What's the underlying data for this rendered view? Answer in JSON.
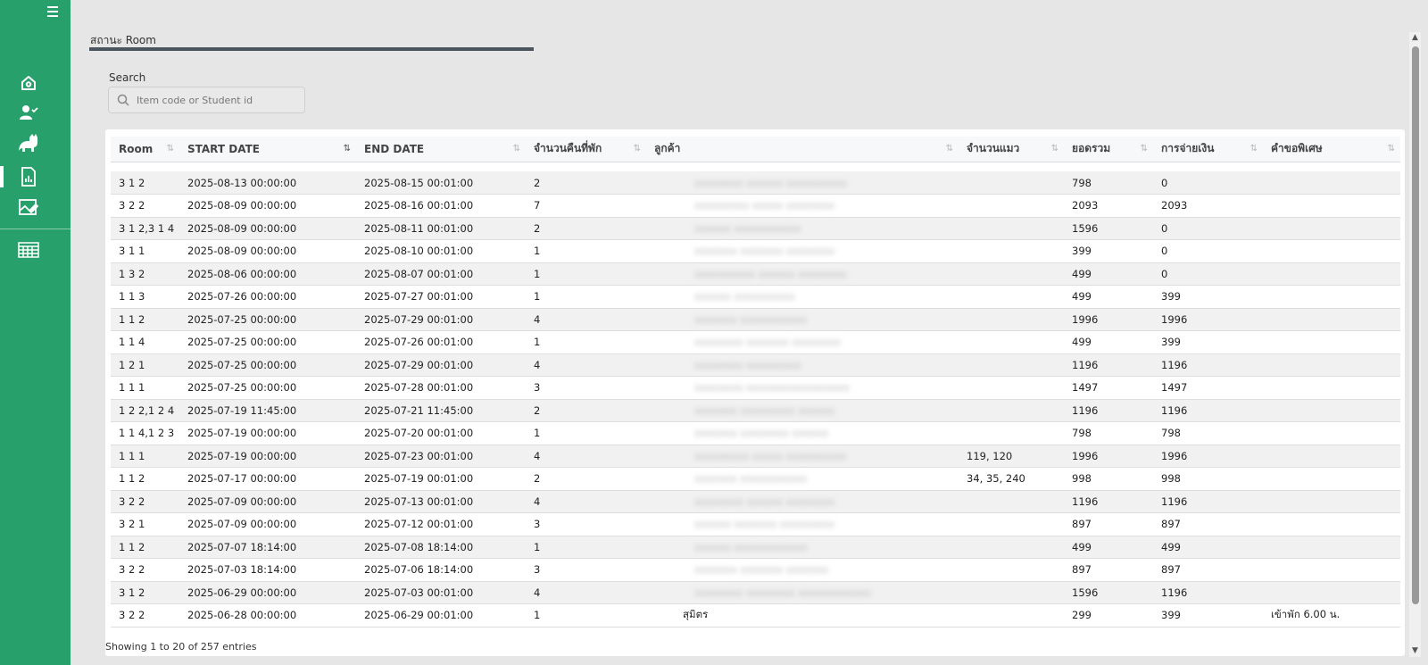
{
  "sidebar": {
    "items": [
      {
        "name": "home-icon"
      },
      {
        "name": "user-check-icon"
      },
      {
        "name": "cat-icon"
      },
      {
        "name": "report-icon",
        "active": true
      },
      {
        "name": "image-edit-icon"
      },
      {
        "name": "calendar-grid-icon"
      }
    ],
    "accent": "#27a06b"
  },
  "breadcrumb": "สถานะ Room",
  "search": {
    "label": "Search",
    "placeholder": "Item code or Student id",
    "value": ""
  },
  "table": {
    "columns": [
      "Room",
      "START DATE",
      "END DATE",
      "จำนวนคืนที่พัก",
      "ลูกค้า",
      "จำนวนแมว",
      "ยอดรวม",
      "การจ่ายเงิน",
      "คำขอพิเศษ"
    ],
    "rows": [
      {
        "room": "3 1 2",
        "start": "2025-08-13 00:00:00",
        "end": "2025-08-15 00:01:00",
        "nights": "2",
        "customer": "xxxxxxxx xxxxxx xxxxxxxxxx",
        "cats": "",
        "total": "798",
        "payment": "0",
        "note": ""
      },
      {
        "room": "3 2 2",
        "start": "2025-08-09 00:00:00",
        "end": "2025-08-16 00:01:00",
        "nights": "7",
        "customer": "xxxxxxxxx xxxxx xxxxxxxx",
        "cats": "",
        "total": "2093",
        "payment": "2093",
        "note": ""
      },
      {
        "room": "3 1 2,3 1 4",
        "start": "2025-08-09 00:00:00",
        "end": "2025-08-11 00:01:00",
        "nights": "2",
        "customer": "xxxxxx xxxxxxxxxxx",
        "cats": "",
        "total": "1596",
        "payment": "0",
        "note": ""
      },
      {
        "room": "3 1 1",
        "start": "2025-08-09 00:00:00",
        "end": "2025-08-10 00:01:00",
        "nights": "1",
        "customer": "xxxxxxx xxxxxxx xxxxxxxx",
        "cats": "",
        "total": "399",
        "payment": "0",
        "note": ""
      },
      {
        "room": "1 3 2",
        "start": "2025-08-06 00:00:00",
        "end": "2025-08-07 00:01:00",
        "nights": "1",
        "customer": "xxxxxxxxxx xxxxxx xxxxxxxx",
        "cats": "",
        "total": "499",
        "payment": "0",
        "note": ""
      },
      {
        "room": "1 1 3",
        "start": "2025-07-26 00:00:00",
        "end": "2025-07-27 00:01:00",
        "nights": "1",
        "customer": "xxxxxx xxxxxxxxxx",
        "cats": "",
        "total": "499",
        "payment": "399",
        "note": ""
      },
      {
        "room": "1 1 2",
        "start": "2025-07-25 00:00:00",
        "end": "2025-07-29 00:01:00",
        "nights": "4",
        "customer": "xxxxxxx xxxxxxxxxxx",
        "cats": "",
        "total": "1996",
        "payment": "1996",
        "note": ""
      },
      {
        "room": "1 1 4",
        "start": "2025-07-25 00:00:00",
        "end": "2025-07-26 00:01:00",
        "nights": "1",
        "customer": "xxxxxxxx xxxxxxx xxxxxxxx",
        "cats": "",
        "total": "499",
        "payment": "399",
        "note": ""
      },
      {
        "room": "1 2 1",
        "start": "2025-07-25 00:00:00",
        "end": "2025-07-29 00:01:00",
        "nights": "4",
        "customer": "xxxxxxxx xxxxxxxxx",
        "cats": "",
        "total": "1196",
        "payment": "1196",
        "note": ""
      },
      {
        "room": "1 1 1",
        "start": "2025-07-25 00:00:00",
        "end": "2025-07-28 00:01:00",
        "nights": "3",
        "customer": "xxxxxxxx xxxxxxxxxxxxxxxxx",
        "cats": "",
        "total": "1497",
        "payment": "1497",
        "note": ""
      },
      {
        "room": "1 2 2,1 2 4",
        "start": "2025-07-19 11:45:00",
        "end": "2025-07-21 11:45:00",
        "nights": "2",
        "customer": "xxxxxxx xxxxxxxxx xxxxxx",
        "cats": "",
        "total": "1196",
        "payment": "1196",
        "note": ""
      },
      {
        "room": "1 1 4,1 2 3",
        "start": "2025-07-19 00:00:00",
        "end": "2025-07-20 00:01:00",
        "nights": "1",
        "customer": "xxxxxxx xxxxxxxx xxxxxx",
        "cats": "",
        "total": "798",
        "payment": "798",
        "note": ""
      },
      {
        "room": "1 1 1",
        "start": "2025-07-19 00:00:00",
        "end": "2025-07-23 00:01:00",
        "nights": "4",
        "customer": "xxxxxxxxx xxxxx xxxxxxxxxx",
        "cats": "119, 120",
        "total": "1996",
        "payment": "1996",
        "note": ""
      },
      {
        "room": "1 1 2",
        "start": "2025-07-17 00:00:00",
        "end": "2025-07-19 00:01:00",
        "nights": "2",
        "customer": "xxxxxxx xxxxxxxxxxx",
        "cats": "34, 35, 240",
        "total": "998",
        "payment": "998",
        "note": ""
      },
      {
        "room": "3 2 2",
        "start": "2025-07-09 00:00:00",
        "end": "2025-07-13 00:01:00",
        "nights": "4",
        "customer": "xxxxxxxx xxxxxx xxxxxxxx",
        "cats": "",
        "total": "1196",
        "payment": "1196",
        "note": ""
      },
      {
        "room": "3 2 1",
        "start": "2025-07-09 00:00:00",
        "end": "2025-07-12 00:01:00",
        "nights": "3",
        "customer": "xxxxxx xxxxxxx xxxxxxxxx",
        "cats": "",
        "total": "897",
        "payment": "897",
        "note": ""
      },
      {
        "room": "1 1 2",
        "start": "2025-07-07 18:14:00",
        "end": "2025-07-08 18:14:00",
        "nights": "1",
        "customer": "xxxxxx xxxxxxxxxxxx",
        "cats": "",
        "total": "499",
        "payment": "499",
        "note": ""
      },
      {
        "room": "3 2 2",
        "start": "2025-07-03 18:14:00",
        "end": "2025-07-06 18:14:00",
        "nights": "3",
        "customer": "xxxxxxx xxxxxxx xxxxxxx",
        "cats": "",
        "total": "897",
        "payment": "897",
        "note": ""
      },
      {
        "room": "3 1 2",
        "start": "2025-06-29 00:00:00",
        "end": "2025-07-03 00:01:00",
        "nights": "4",
        "customer": "xxxxxxxx xxxxxxxx xxxxxxxxxxxx",
        "cats": "",
        "total": "1596",
        "payment": "1196",
        "note": ""
      },
      {
        "room": "3 2 2",
        "start": "2025-06-28 00:00:00",
        "end": "2025-06-29 00:01:00",
        "nights": "1",
        "customer": "สุมิตร",
        "cats": "",
        "total": "299",
        "payment": "399",
        "note": "เข้าพัก 6.00 น."
      }
    ]
  },
  "footer": {
    "info": "Showing 1 to 20 of 257 entries"
  }
}
